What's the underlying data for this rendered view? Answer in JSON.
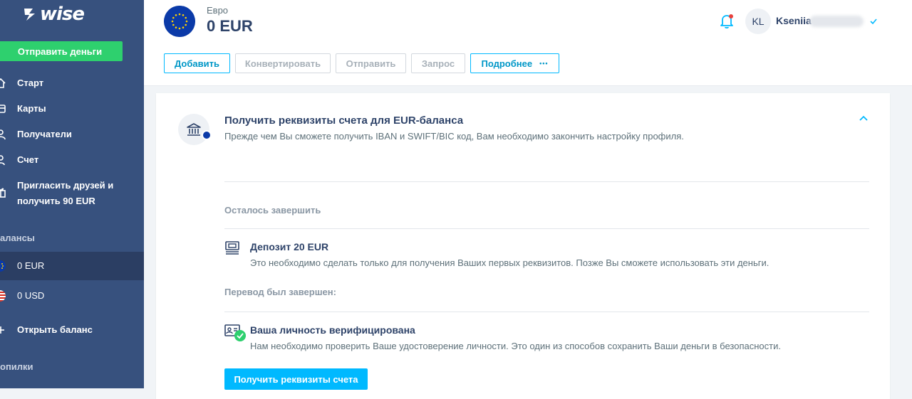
{
  "brand": {
    "logo_text": "wise"
  },
  "sidebar": {
    "send_label": "Отправить деньги",
    "nav": [
      {
        "label": "Старт",
        "icon": "home-icon"
      },
      {
        "label": "Карты",
        "icon": "card-icon"
      },
      {
        "label": "Получатели",
        "icon": "recipients-icon"
      },
      {
        "label": "Счет",
        "icon": "account-icon"
      },
      {
        "label": "Пригласить друзей и получить 90 EUR",
        "icon": "gift-icon"
      }
    ],
    "balances_title": "алансы",
    "balances": [
      {
        "label": "0 EUR",
        "flag": "eu-flag-icon",
        "active": true
      },
      {
        "label": "0 USD",
        "flag": "us-flag-icon",
        "active": false
      }
    ],
    "open_balance_label": "Открыть баланс",
    "jars_title": "опилки"
  },
  "header": {
    "currency_label": "Евро",
    "amount": "0 EUR",
    "user_initials": "KL",
    "user_name": "Kseniia",
    "actions": [
      {
        "label": "Добавить",
        "primary": true
      },
      {
        "label": "Конвертировать",
        "primary": false
      },
      {
        "label": "Отправить",
        "primary": false
      },
      {
        "label": "Запрос",
        "primary": false
      },
      {
        "label": "Подробнее",
        "primary": true
      }
    ],
    "more_dots": "•••"
  },
  "card": {
    "title": "Получить реквизиты счета для EUR-баланса",
    "subtitle": "Прежде чем Вы сможете получить IBAN и SWIFT/BIC код, Вам необходимо закончить настройку профиля.",
    "remaining_label": "Осталось завершить",
    "deposit": {
      "title": "Депозит 20 EUR",
      "desc": "Это необходимо сделать только для получения Ваших первых реквизитов. Позже Вы сможете использовать эти деньги."
    },
    "completed_label": "Перевод был завершен:",
    "verified": {
      "title": "Ваша личность верифицирована",
      "desc": "Нам необходимо проверить Ваше удостоверение личности. Это один из способов сохранить Ваши деньги в безопасности."
    },
    "cta_label": "Получить реквизиты счета"
  },
  "colors": {
    "sidebar": "#37517e",
    "sidebar_active": "#2b3e63",
    "green": "#2ed06e",
    "accent": "#00b9ff",
    "navy_text": "#2e4369"
  }
}
